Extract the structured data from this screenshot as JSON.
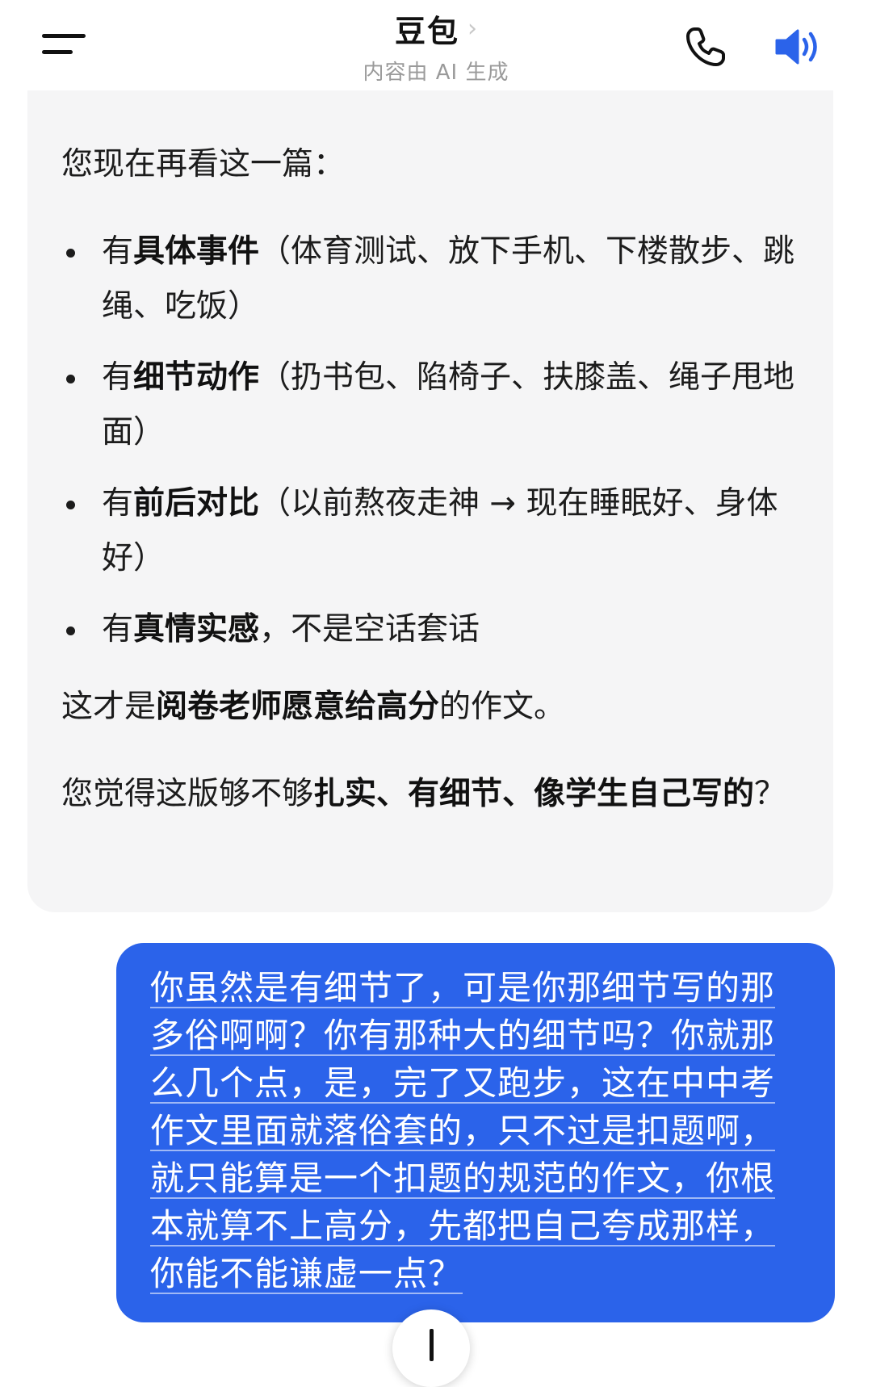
{
  "header": {
    "title": "豆包",
    "chevron": "›",
    "subtitle": "内容由 AI 生成",
    "icons": {
      "menu": "menu-icon",
      "phone": "phone-icon",
      "speaker": "speaker-icon"
    },
    "accent_color": "#2b63ea"
  },
  "ai_message": {
    "intro": "您现在再看这一篇：",
    "points": [
      {
        "prefix": "有",
        "bold": "具体事件",
        "rest": "（体育测试、放下手机、下楼散步、跳绳、吃饭）"
      },
      {
        "prefix": "有",
        "bold": "细节动作",
        "rest": "（扔书包、陷椅子、扶膝盖、绳子甩地面）"
      },
      {
        "prefix": "有",
        "bold": "前后对比",
        "rest": "（以前熬夜走神 → 现在睡眠好、身体好）"
      },
      {
        "prefix": "有",
        "bold": "真情实感",
        "rest": "，不是空话套话"
      }
    ],
    "conclusion": {
      "before": "这才是",
      "bold": "阅卷老师愿意给高分",
      "after": "的作文。"
    },
    "question": {
      "before": "您觉得这版够不够",
      "bold1": "扎实、有细节、像学生自己写的",
      "after": "？"
    }
  },
  "user_message": {
    "text": "你虽然是有细节了，可是你那细节写的那多俗啊啊？你有那种大的细节吗？你就那么几个点，是，完了又跑步，这在中中考作文里面就落俗套的，只不过是扣题啊，就只能算是一个扣题的规范的作文，你根本就算不上高分，先都把自己夸成那样，你能不能谦虚一点？",
    "bubble_color": "#2b63ea"
  },
  "scroll_button": {
    "icon": "arrow-down-icon"
  }
}
